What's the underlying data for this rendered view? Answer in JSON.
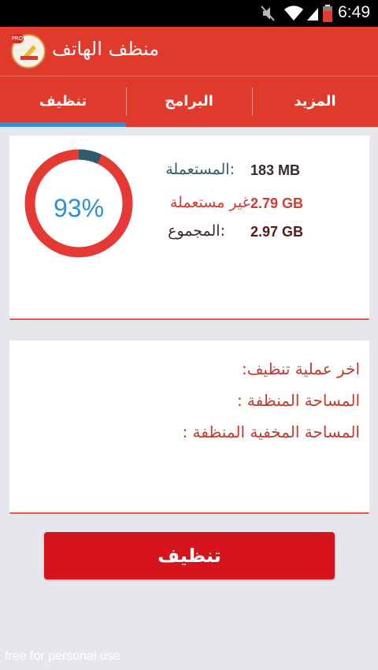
{
  "status_bar": {
    "time": "6:49",
    "icons": [
      "mute-icon",
      "wifi-icon",
      "signal-icon",
      "battery-icon"
    ]
  },
  "app_bar": {
    "title": "منظف الهاتف",
    "icon": "app-logo-icon",
    "icon_badge": "PRO"
  },
  "tabs": {
    "items": [
      {
        "label": "المزيد"
      },
      {
        "label": "البرامج"
      },
      {
        "label": "تنظيف"
      }
    ],
    "active": "تنظيف"
  },
  "storage": {
    "percent_text": "93%",
    "percent_value": 93,
    "used_label": "المستعملة:",
    "used_value": "183 MB",
    "free_label": "غير مستعملة:",
    "free_value": "2.79 GB",
    "total_label": "المجموع:",
    "total_value": "2.97 GB"
  },
  "history": {
    "last_clean_label": "اخر عملية تنظيف:",
    "cleaned_space_label": "المساحة المنظفة :",
    "hidden_cleaned_space_label": "المساحة المخفية المنظفة :"
  },
  "actions": {
    "clean_label": "تنظيف"
  },
  "watermark": "free for personal use",
  "colors": {
    "accent": "#e03a2c",
    "tab_indicator": "#2f8fd7",
    "button": "#d6141d",
    "gauge_free": "#e53935",
    "gauge_used": "#2f5b6b",
    "percent_text": "#2f8fd7"
  }
}
